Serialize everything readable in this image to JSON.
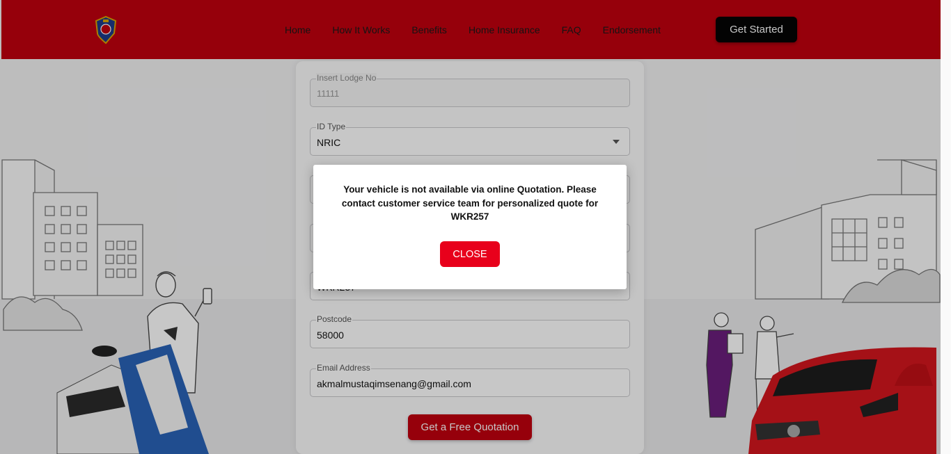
{
  "header": {
    "nav": [
      "Home",
      "How It Works",
      "Benefits",
      "Home Insurance",
      "FAQ",
      "Endorsement"
    ],
    "cta_label": "Get Started"
  },
  "form": {
    "lodge": {
      "label": "Insert Lodge No",
      "placeholder": "11111"
    },
    "id_type": {
      "label": "ID Type",
      "value": "NRIC"
    },
    "vehicle_partial": "WKR257",
    "postcode": {
      "label": "Postcode",
      "value": "58000"
    },
    "email": {
      "label": "Email Address",
      "value": "akmalmustaqimsenang@gmail.com"
    },
    "submit_label": "Get a Free Quotation"
  },
  "modal": {
    "message": "Your vehicle is not available via online Quotation. Please contact customer service team for personalized quote for WKR257",
    "close_label": "CLOSE"
  },
  "colors": {
    "brand_red": "#c0000f",
    "close_red": "#e8001b",
    "black": "#050505"
  },
  "icons": [
    "crest-logo-icon",
    "chevron-down-icon"
  ]
}
